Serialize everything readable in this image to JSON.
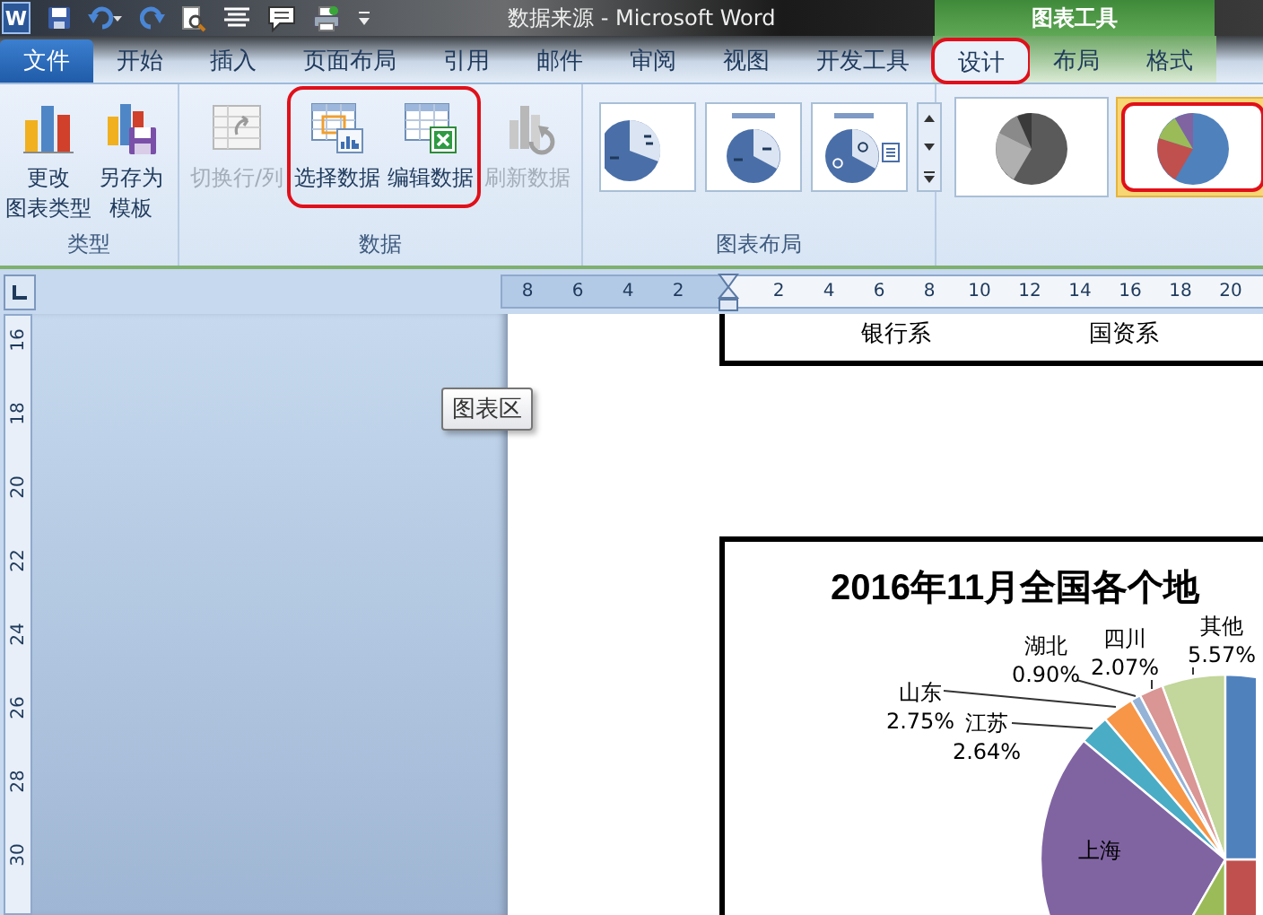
{
  "window": {
    "app_letter": "W",
    "title": "数据来源 - Microsoft Word"
  },
  "context_tab_group": {
    "label": "图表工具"
  },
  "tabs": [
    {
      "label": "文件",
      "kind": "file",
      "context": false,
      "selected": false,
      "highlighted": false
    },
    {
      "label": "开始",
      "kind": "normal",
      "context": false,
      "selected": false,
      "highlighted": false
    },
    {
      "label": "插入",
      "kind": "normal",
      "context": false,
      "selected": false,
      "highlighted": false
    },
    {
      "label": "页面布局",
      "kind": "normal",
      "context": false,
      "selected": false,
      "highlighted": false
    },
    {
      "label": "引用",
      "kind": "normal",
      "context": false,
      "selected": false,
      "highlighted": false
    },
    {
      "label": "邮件",
      "kind": "normal",
      "context": false,
      "selected": false,
      "highlighted": false
    },
    {
      "label": "审阅",
      "kind": "normal",
      "context": false,
      "selected": false,
      "highlighted": false
    },
    {
      "label": "视图",
      "kind": "normal",
      "context": false,
      "selected": false,
      "highlighted": false
    },
    {
      "label": "开发工具",
      "kind": "normal",
      "context": false,
      "selected": false,
      "highlighted": false
    },
    {
      "label": "设计",
      "kind": "normal",
      "context": true,
      "selected": true,
      "highlighted": true
    },
    {
      "label": "布局",
      "kind": "normal",
      "context": true,
      "selected": false,
      "highlighted": false
    },
    {
      "label": "格式",
      "kind": "normal",
      "context": true,
      "selected": false,
      "highlighted": false
    }
  ],
  "ribbon": {
    "groups": [
      {
        "kind": "buttons",
        "label": "类型",
        "buttons": [
          {
            "kind": "change-type",
            "lines": [
              "更改",
              "图表类型"
            ],
            "disabled": false,
            "highlighted": false
          },
          {
            "kind": "save-template",
            "lines": [
              "另存为",
              "模板"
            ],
            "disabled": false,
            "highlighted": false
          }
        ]
      },
      {
        "kind": "buttons",
        "label": "数据",
        "buttons": [
          {
            "kind": "switch",
            "lines": [
              "切换行/列"
            ],
            "disabled": true,
            "highlighted": false
          },
          {
            "kind": "select-data",
            "lines": [
              "选择数据"
            ],
            "disabled": false,
            "highlighted": true
          },
          {
            "kind": "edit-data",
            "lines": [
              "编辑数据"
            ],
            "disabled": false,
            "highlighted": true
          },
          {
            "kind": "refresh",
            "lines": [
              "刷新数据"
            ],
            "disabled": true,
            "highlighted": false
          }
        ]
      },
      {
        "kind": "layouts",
        "label": "图表布局",
        "layouts": [
          {
            "kind": "labels"
          },
          {
            "kind": "title-labels"
          },
          {
            "kind": "title-percent-legend"
          }
        ]
      },
      {
        "kind": "styles",
        "styles": [
          {
            "kind": "grayscale",
            "selected": false,
            "highlighted": false
          },
          {
            "kind": "color",
            "selected": true,
            "highlighted": true
          }
        ]
      }
    ]
  },
  "ruler": {
    "horizontal": [
      "8",
      "6",
      "4",
      "2",
      "2",
      "4",
      "6",
      "8",
      "10",
      "12",
      "14",
      "16",
      "18",
      "20"
    ],
    "vertical": [
      "16",
      "18",
      "20",
      "22",
      "24",
      "26",
      "28",
      "30"
    ]
  },
  "tooltip": {
    "text": "图表区"
  },
  "document": {
    "table_row": [
      "银行系",
      "国资系"
    ],
    "chart": {
      "title": "2016年11月全国各个地",
      "labels": [
        {
          "name": "湖北",
          "value": "0.90%"
        },
        {
          "name": "四川",
          "value": "2.07%"
        },
        {
          "name": "其他",
          "value": "5.57%"
        },
        {
          "name": "山东",
          "value": "2.75%"
        },
        {
          "name": "江苏",
          "value": "2.64%"
        },
        {
          "name": "上海"
        }
      ]
    }
  }
}
